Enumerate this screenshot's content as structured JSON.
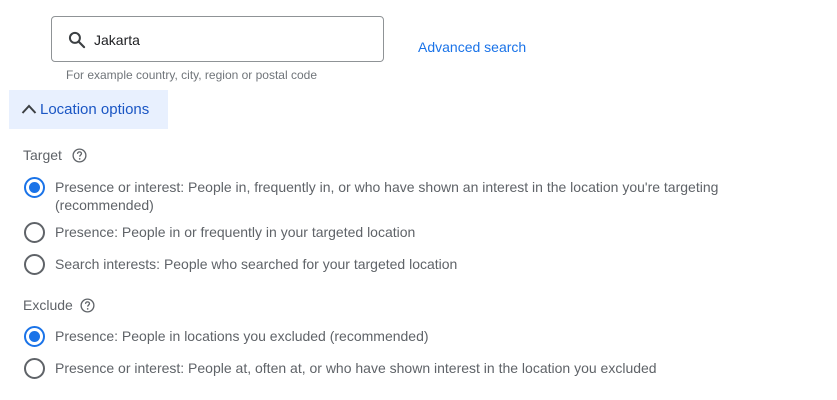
{
  "search": {
    "value": "Jakarta",
    "hint": "For example country, city, region or postal code",
    "advanced_link": "Advanced search"
  },
  "location_options": {
    "label": "Location options",
    "expanded": true
  },
  "target": {
    "label": "Target",
    "options": [
      {
        "label": "Presence or interest: People in, frequently in, or who have shown an interest in the location you're targeting",
        "label_suffix": "(recommended)",
        "checked": true
      },
      {
        "label": "Presence: People in or frequently in your targeted location",
        "checked": false
      },
      {
        "label": "Search interests: People who searched for your targeted location",
        "checked": false
      }
    ]
  },
  "exclude": {
    "label": "Exclude",
    "options": [
      {
        "label": "Presence: People in locations you excluded (recommended)",
        "checked": true
      },
      {
        "label": "Presence or interest: People at, often at, or who have shown interest in the location you excluded",
        "checked": false
      }
    ]
  },
  "colors": {
    "accent": "#1a73e8",
    "options_bg": "#e8f0fe",
    "text": "#5f6368"
  },
  "icons": {
    "search": "search-icon",
    "chevron": "chevron-up-icon",
    "help": "help-circle-icon"
  }
}
